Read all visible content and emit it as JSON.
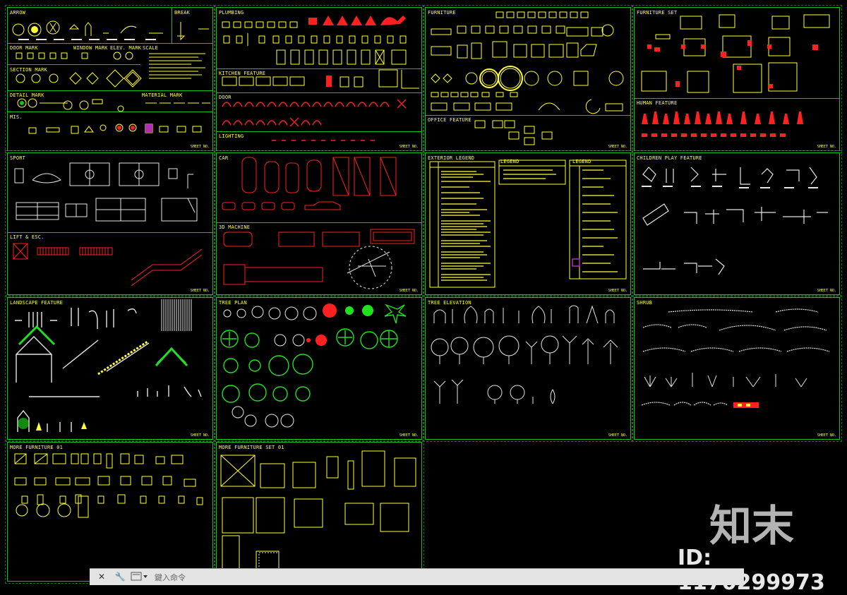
{
  "sheets": [
    {
      "id": "s1",
      "sections": [
        "ARROW",
        "BREAK",
        "DOOR MARK",
        "WINDOW MARK",
        "ELEV. MARK",
        "SCALE",
        "SECTION MARK",
        "DETAIL MARK",
        "MATERIAL MARK",
        "MIS."
      ]
    },
    {
      "id": "s2",
      "sections": [
        "PLUMBING",
        "KITCHEN FEATURE",
        "DOOR",
        "LIGHTING"
      ]
    },
    {
      "id": "s3",
      "sections": [
        "FURNITURE",
        "OFFICE FEATURE"
      ]
    },
    {
      "id": "s4",
      "sections": [
        "FURNITURE SET",
        "HUMAN FEATURE"
      ]
    },
    {
      "id": "s5",
      "sections": [
        "SPORT",
        "LIFT & ESC."
      ]
    },
    {
      "id": "s6",
      "sections": [
        "CAR",
        "3D MACHINE"
      ]
    },
    {
      "id": "s7",
      "sections": [
        "EXTERIOR LEGEND",
        "LEGEND",
        "LEGEND"
      ]
    },
    {
      "id": "s8",
      "sections": [
        "CHILDREN PLAY FEATURE"
      ]
    },
    {
      "id": "s9",
      "sections": [
        "LANDSCAPE FEATURE"
      ]
    },
    {
      "id": "s10",
      "sections": [
        "TREE PLAN"
      ]
    },
    {
      "id": "s11",
      "sections": [
        "TREE ELEVATION"
      ]
    },
    {
      "id": "s12",
      "sections": [
        "SHRUB"
      ]
    },
    {
      "id": "s13",
      "sections": [
        "MORE FURNITURE 01"
      ]
    },
    {
      "id": "s14",
      "sections": [
        "MORE FURNITURE SET 01"
      ]
    }
  ],
  "titleblock_text": "SHEET NO.",
  "watermark": {
    "brand": "知末",
    "id": "ID: 1170299973"
  },
  "command_line": {
    "placeholder": "鍵入命令",
    "close_icon": "close-icon",
    "settings_icon": "wrench-icon",
    "history_icon": "command-history-icon"
  },
  "colors": {
    "border": "#12c21a",
    "text": "#ffff3a",
    "red": "#ff2020",
    "white": "#e6e6e6",
    "green": "#1fe21f"
  }
}
